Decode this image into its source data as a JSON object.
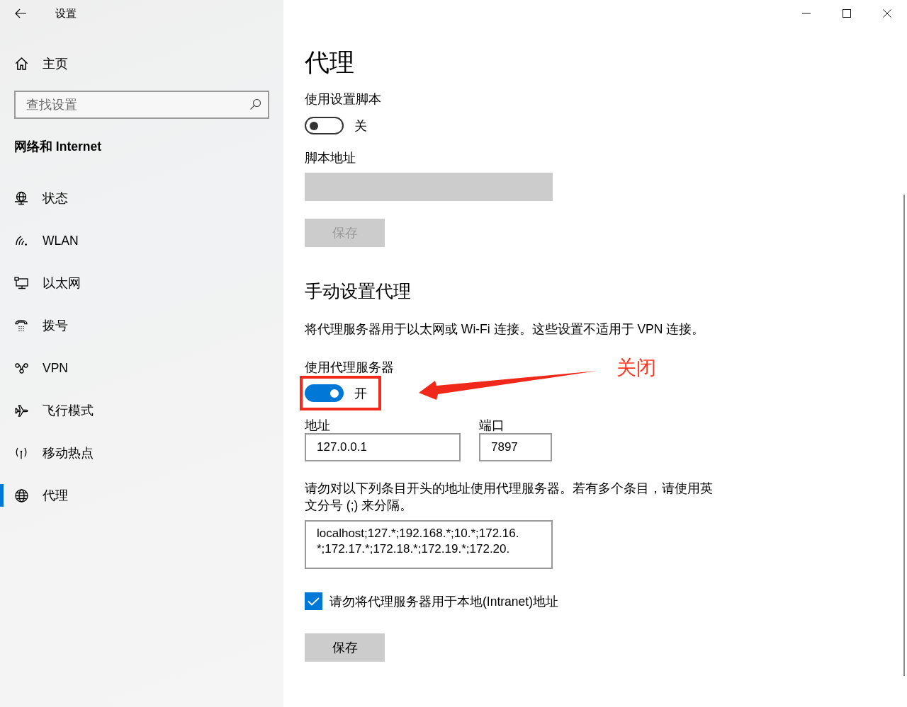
{
  "window": {
    "title": "设置"
  },
  "sidebar": {
    "home": {
      "label": "主页"
    },
    "search": {
      "placeholder": "查找设置"
    },
    "section_title": "网络和 Internet",
    "items": [
      {
        "label": "状态",
        "selected": false
      },
      {
        "label": "WLAN",
        "selected": false
      },
      {
        "label": "以太网",
        "selected": false
      },
      {
        "label": "拨号",
        "selected": false
      },
      {
        "label": "VPN",
        "selected": false
      },
      {
        "label": "飞行模式",
        "selected": false
      },
      {
        "label": "移动热点",
        "selected": false
      },
      {
        "label": "代理",
        "selected": true
      }
    ]
  },
  "main": {
    "title": "代理",
    "script_toggle": {
      "label": "使用设置脚本",
      "on": false,
      "state_text": "关"
    },
    "script_address": {
      "label": "脚本地址",
      "disabled": true
    },
    "script_save": {
      "label": "保存",
      "disabled": true
    },
    "manual_heading": "手动设置代理",
    "manual_description": "将代理服务器用于以太网或 Wi-Fi 连接。这些设置不适用于 VPN 连接。",
    "proxy_toggle": {
      "label": "使用代理服务器",
      "on": true,
      "state_text": "开"
    },
    "address": {
      "label": "地址",
      "value": "127.0.0.1"
    },
    "port": {
      "label": "端口",
      "value": "7897"
    },
    "exceptions_description": "请勿对以下列条目开头的地址使用代理服务器。若有多个条目，请使用英文分号 (;) 来分隔。",
    "exceptions": {
      "lines": [
        "localhost;127.*;192.168.*;10.*;172.16.",
        "*;172.17.*;172.18.*;172.19.*;172.20."
      ]
    },
    "intranet_bypass": {
      "label": "请勿将代理服务器用于本地(Intranet)地址",
      "checked": true
    },
    "save": {
      "label": "保存",
      "disabled": false
    }
  },
  "annotation": {
    "label": "关闭"
  }
}
